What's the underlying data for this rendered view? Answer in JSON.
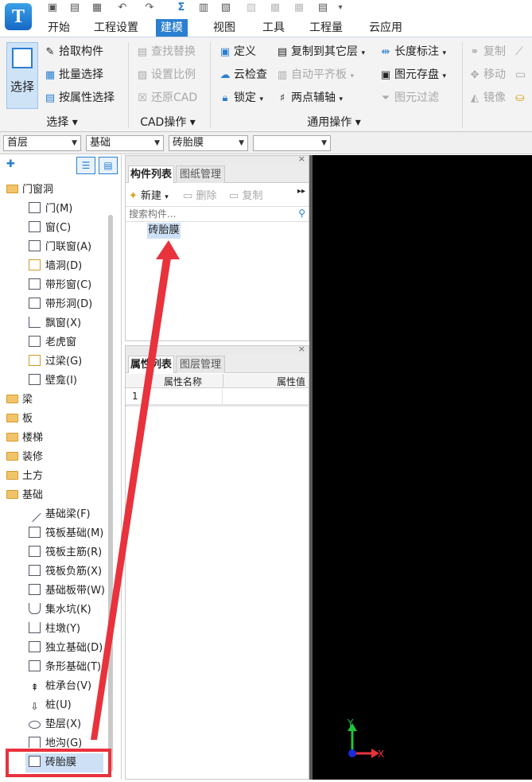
{
  "quick_access": {
    "undo": "↶",
    "redo": "↷",
    "sum": "Σ"
  },
  "menu_tabs": [
    "开始",
    "工程设置",
    "建模",
    "视图",
    "工具",
    "工程量",
    "云应用"
  ],
  "ribbon": {
    "select_group": {
      "big_button": "选择",
      "items": [
        "拾取构件",
        "批量选择",
        "按属性选择"
      ],
      "label": "选择"
    },
    "cad_group": {
      "items": [
        "查找替换",
        "设置比例",
        "还原CAD"
      ],
      "label": "CAD操作"
    },
    "general_group": {
      "col1": [
        "定义",
        "云检查",
        "锁定"
      ],
      "col2": [
        "复制到其它层",
        "自动平齐板",
        "两点辅轴"
      ],
      "col3": [
        "长度标注",
        "图元存盘",
        "图元过滤"
      ],
      "label": "通用操作"
    },
    "edit_group": {
      "items": [
        "复制",
        "移动",
        "镜像"
      ]
    }
  },
  "combos": {
    "floor": "首层",
    "category": "基础",
    "component": "砖胎膜",
    "extra": ""
  },
  "tree": {
    "groups": [
      {
        "label": "门窗洞",
        "expanded": true,
        "children": [
          "门(M)",
          "窗(C)",
          "门联窗(A)",
          "墙洞(D)",
          "带形窗(C)",
          "带形洞(D)",
          "飘窗(X)",
          "老虎窗",
          "过梁(G)",
          "壁龛(I)"
        ]
      },
      {
        "label": "梁",
        "expanded": false
      },
      {
        "label": "板",
        "expanded": false
      },
      {
        "label": "楼梯",
        "expanded": false
      },
      {
        "label": "装修",
        "expanded": false
      },
      {
        "label": "土方",
        "expanded": false
      },
      {
        "label": "基础",
        "expanded": true,
        "children": [
          "基础梁(F)",
          "筏板基础(M)",
          "筏板主筋(R)",
          "筏板负筋(X)",
          "基础板带(W)",
          "集水坑(K)",
          "柱墩(Y)",
          "独立基础(D)",
          "条形基础(T)",
          "桩承台(V)",
          "桩(U)",
          "垫层(X)",
          "地沟(G)",
          "砖胎膜"
        ]
      }
    ],
    "selected": "砖胎膜"
  },
  "component_panel": {
    "tabs": [
      "构件列表",
      "图纸管理"
    ],
    "toolbar": {
      "new": "新建",
      "delete": "删除",
      "copy": "复制"
    },
    "search_placeholder": "搜索构件...",
    "items": [
      "砖胎膜"
    ]
  },
  "property_panel": {
    "tabs": [
      "属性列表",
      "图层管理"
    ],
    "columns": [
      "属性名称",
      "属性值"
    ],
    "rows": [
      {
        "index": "1",
        "name": "",
        "value": ""
      }
    ]
  },
  "axis": {
    "x": "X",
    "y": "Y"
  },
  "colors": {
    "accent": "#2a7fd0",
    "annotation": "#e8323c",
    "canvas": "#000000"
  }
}
